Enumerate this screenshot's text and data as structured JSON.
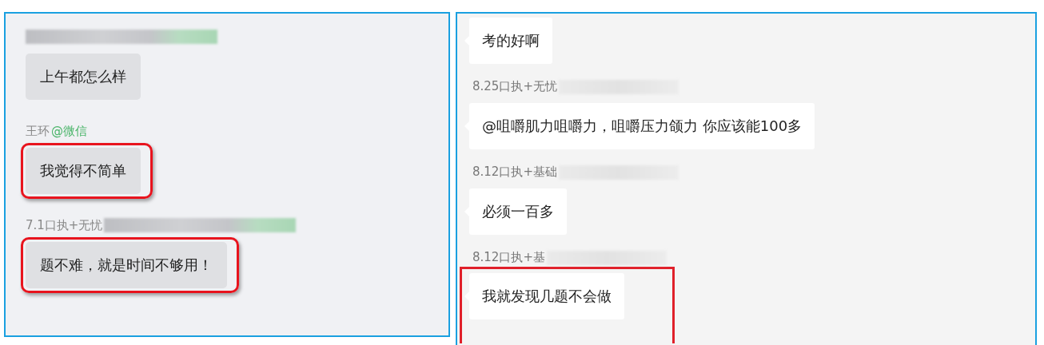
{
  "panels": [
    {
      "kind": "desktop",
      "messages": [
        {
          "sender": {
            "redacted": true,
            "redacted_tag": true
          },
          "text": "上午都怎么样",
          "highlighted": false
        },
        {
          "sender": {
            "name": "王环",
            "tag": "@微信",
            "redacted": false
          },
          "text": "我觉得不简单",
          "highlighted": true
        },
        {
          "sender": {
            "name": "7.1口执+无忧",
            "redacted": true,
            "redacted_tag": true
          },
          "text": "题不难，就是时间不够用！",
          "highlighted": true
        }
      ]
    },
    {
      "kind": "classic",
      "messages": [
        {
          "text": "考的好啊",
          "highlighted": false
        },
        {
          "sender": {
            "name": "8.25口执+无忧",
            "redacted": true
          },
          "text": "@咀嚼肌力咀嚼力，咀嚼压力颌力 你应该能100多",
          "highlighted": false
        },
        {
          "sender": {
            "name": "8.12口执+基础",
            "redacted": true
          },
          "text": "必须一百多",
          "highlighted": false
        },
        {
          "sender": {
            "name": "8.12口执+基",
            "redacted": true
          },
          "text": "我就发现几题不会做",
          "highlighted": true
        }
      ]
    }
  ]
}
